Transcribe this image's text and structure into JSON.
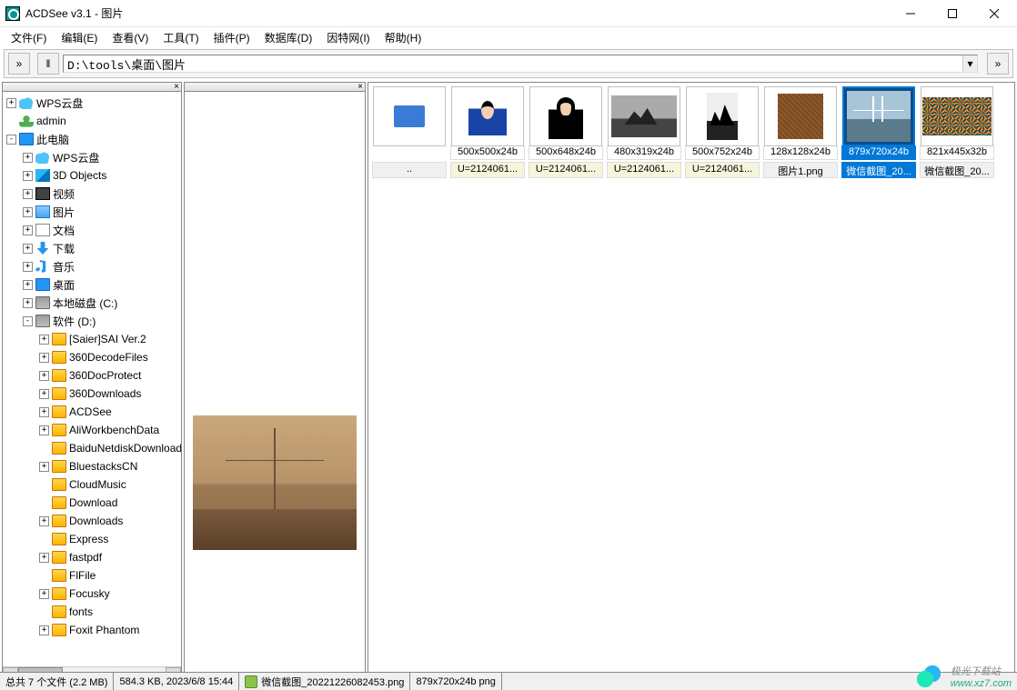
{
  "window": {
    "title": "ACDSee v3.1 - 图片"
  },
  "menu": {
    "file": "文件(F)",
    "edit": "编辑(E)",
    "view": "查看(V)",
    "tools": "工具(T)",
    "plugins": "插件(P)",
    "database": "数据库(D)",
    "internet": "因特网(I)",
    "help": "帮助(H)"
  },
  "path": {
    "value": "D:\\tools\\桌面\\图片"
  },
  "tree": [
    {
      "depth": 0,
      "exp": "+",
      "icon": "cloud",
      "label": "WPS云盘"
    },
    {
      "depth": 0,
      "exp": "",
      "icon": "user",
      "label": "admin"
    },
    {
      "depth": 0,
      "exp": "-",
      "icon": "monitor",
      "label": "此电脑"
    },
    {
      "depth": 1,
      "exp": "+",
      "icon": "cloud",
      "label": "WPS云盘"
    },
    {
      "depth": 1,
      "exp": "+",
      "icon": "cube",
      "label": "3D Objects"
    },
    {
      "depth": 1,
      "exp": "+",
      "icon": "vid",
      "label": "视频"
    },
    {
      "depth": 1,
      "exp": "+",
      "icon": "img",
      "label": "图片"
    },
    {
      "depth": 1,
      "exp": "+",
      "icon": "doc",
      "label": "文档"
    },
    {
      "depth": 1,
      "exp": "+",
      "icon": "down",
      "label": "下载"
    },
    {
      "depth": 1,
      "exp": "+",
      "icon": "music",
      "label": "音乐"
    },
    {
      "depth": 1,
      "exp": "+",
      "icon": "monitor",
      "label": "桌面"
    },
    {
      "depth": 1,
      "exp": "+",
      "icon": "disk",
      "label": "本地磁盘 (C:)"
    },
    {
      "depth": 1,
      "exp": "-",
      "icon": "disk",
      "label": "软件 (D:)"
    },
    {
      "depth": 2,
      "exp": "+",
      "icon": "folder",
      "label": "[Saier]SAI Ver.2"
    },
    {
      "depth": 2,
      "exp": "+",
      "icon": "folder",
      "label": "360DecodeFiles"
    },
    {
      "depth": 2,
      "exp": "+",
      "icon": "folder",
      "label": "360DocProtect"
    },
    {
      "depth": 2,
      "exp": "+",
      "icon": "folder",
      "label": "360Downloads"
    },
    {
      "depth": 2,
      "exp": "+",
      "icon": "folder",
      "label": "ACDSee"
    },
    {
      "depth": 2,
      "exp": "+",
      "icon": "folder",
      "label": "AliWorkbenchData"
    },
    {
      "depth": 2,
      "exp": "",
      "icon": "folder",
      "label": "BaiduNetdiskDownload"
    },
    {
      "depth": 2,
      "exp": "+",
      "icon": "folder",
      "label": "BluestacksCN"
    },
    {
      "depth": 2,
      "exp": "",
      "icon": "folder",
      "label": "CloudMusic"
    },
    {
      "depth": 2,
      "exp": "",
      "icon": "folder",
      "label": "Download"
    },
    {
      "depth": 2,
      "exp": "+",
      "icon": "folder",
      "label": "Downloads"
    },
    {
      "depth": 2,
      "exp": "",
      "icon": "folder",
      "label": "Express"
    },
    {
      "depth": 2,
      "exp": "+",
      "icon": "folder",
      "label": "fastpdf"
    },
    {
      "depth": 2,
      "exp": "",
      "icon": "folder",
      "label": "FlFile"
    },
    {
      "depth": 2,
      "exp": "+",
      "icon": "folder",
      "label": "Focusky"
    },
    {
      "depth": 2,
      "exp": "",
      "icon": "folder",
      "label": "fonts"
    },
    {
      "depth": 2,
      "exp": "+",
      "icon": "folder",
      "label": "Foxit Phantom"
    }
  ],
  "thumbnails": [
    {
      "ph": "folder",
      "dim": "",
      "name": "..",
      "nameClass": "plain",
      "selected": false
    },
    {
      "ph": "portrait1",
      "dim": "500x500x24b",
      "name": "U=2124061...",
      "nameClass": "",
      "selected": false
    },
    {
      "ph": "portrait2",
      "dim": "500x648x24b",
      "name": "U=2124061...",
      "nameClass": "",
      "selected": false
    },
    {
      "ph": "landscape",
      "dim": "480x319x24b",
      "name": "U=2124061...",
      "nameClass": "",
      "selected": false
    },
    {
      "ph": "tall",
      "dim": "500x752x24b",
      "name": "U=2124061...",
      "nameClass": "",
      "selected": false
    },
    {
      "ph": "texture",
      "dim": "128x128x24b",
      "name": "图片1.png",
      "nameClass": "plain",
      "selected": false
    },
    {
      "ph": "bridge",
      "dim": "879x720x24b",
      "name": "微信截图_20...",
      "nameClass": "",
      "selected": true
    },
    {
      "ph": "crowd",
      "dim": "821x445x32b",
      "name": "微信截图_20...",
      "nameClass": "plain",
      "selected": false
    }
  ],
  "status": {
    "count": "总共 7 个文件 (2.2 MB)",
    "fileinfo": "584.3 KB, 2023/6/8 15:44",
    "filename": "微信截图_20221226082453.png",
    "dims": "879x720x24b png"
  },
  "watermark": {
    "text": "极光下载站",
    "url": "www.xz7.com"
  }
}
